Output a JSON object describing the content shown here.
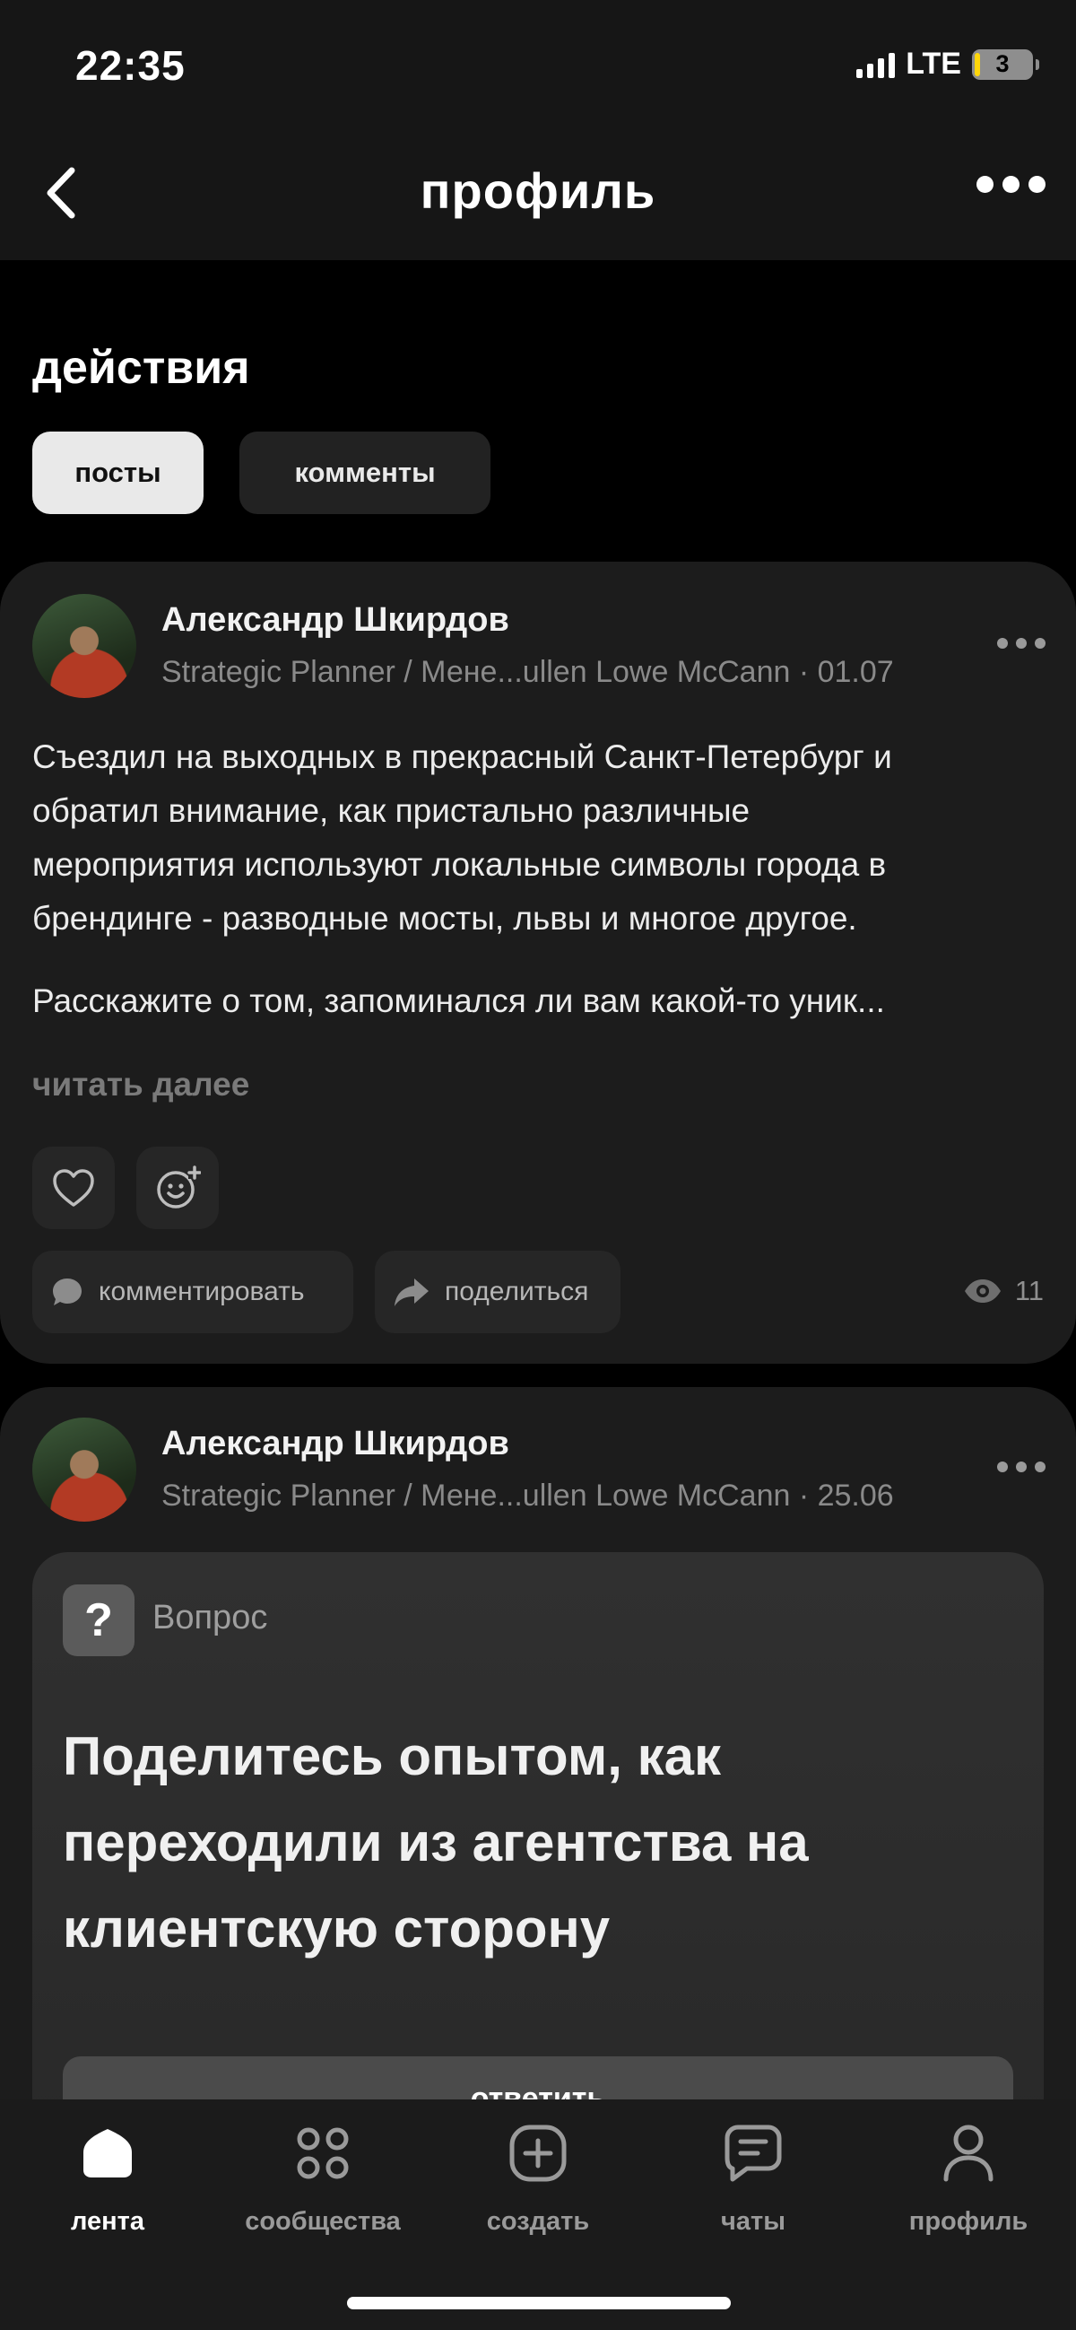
{
  "status_bar": {
    "time": "22:35",
    "network": "LTE",
    "battery": "3"
  },
  "header": {
    "title": "профиль"
  },
  "actions": {
    "title": "действия",
    "tabs": [
      {
        "label": "посты",
        "active": true
      },
      {
        "label": "комменты",
        "active": false
      }
    ]
  },
  "posts": [
    {
      "author": "Александр Шкирдов",
      "meta": "Strategic Planner / Мене...ullen Lowe McCann · 01.07",
      "lines": [
        "Съездил на выходных в прекрасный Санкт-Петербург и",
        "обратил внимание, как пристально различные",
        "мероприятия используют локальные символы города в",
        "брендинге - разводные мосты, львы и многое другое."
      ],
      "lines2": [
        "Расскажите о том, запоминался ли вам какой-то уник..."
      ],
      "read_more": "читать далее",
      "comment_label": "комментировать",
      "share_label": "поделиться",
      "views": "11"
    },
    {
      "author": "Александр Шкирдов",
      "meta": "Strategic Planner / Мене...ullen Lowe McCann · 25.06",
      "question_badge": "?",
      "question_label": "Вопрос",
      "question_lines": [
        "Поделитесь опытом, как",
        "переходили из агентства на",
        "клиентскую сторону"
      ],
      "answer_label": "ответить"
    }
  ],
  "tabbar": [
    {
      "label": "лента",
      "icon": "home-icon",
      "active": true
    },
    {
      "label": "сообщества",
      "icon": "communities-icon",
      "active": false
    },
    {
      "label": "создать",
      "icon": "create-plus-icon",
      "active": false
    },
    {
      "label": "чаты",
      "icon": "chat-icon",
      "active": false
    },
    {
      "label": "профиль",
      "icon": "profile-icon",
      "active": false
    }
  ],
  "colors": {
    "background": "#000000",
    "card": "#1c1c1c",
    "active_chip": "#e9e9e9",
    "muted_text": "#8a8a8a"
  }
}
